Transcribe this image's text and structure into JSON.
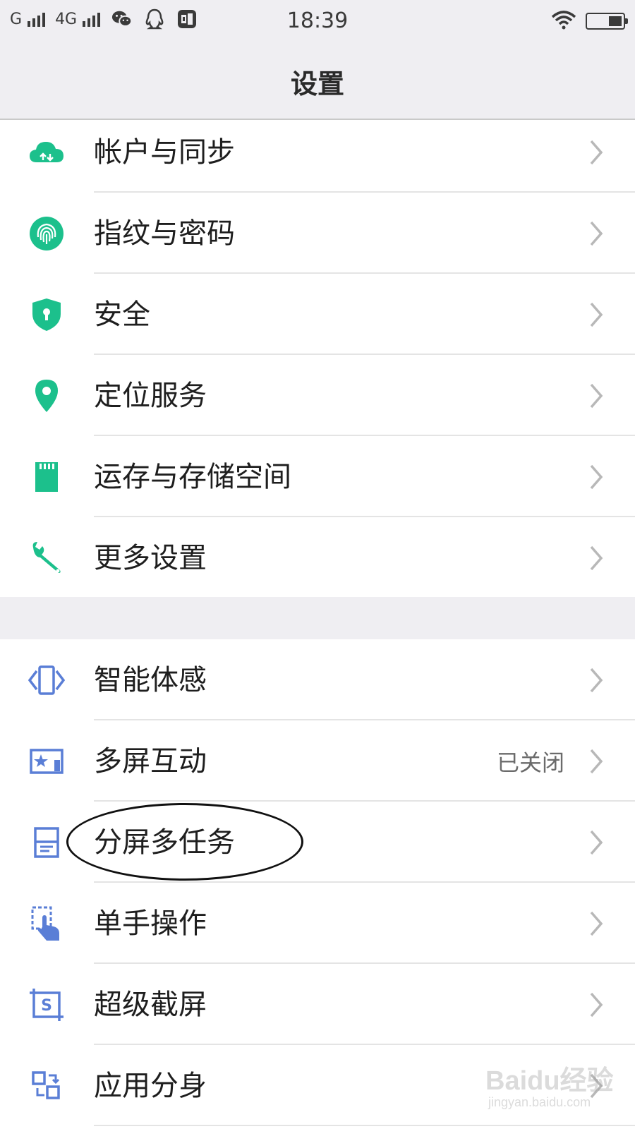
{
  "status_bar": {
    "carrier1": "G",
    "carrier2": "4G",
    "time": "18:39",
    "icons": [
      "signal-bars",
      "signal-bars",
      "wechat-icon",
      "qq-icon",
      "music-app-icon",
      "wifi-icon",
      "battery-icon"
    ]
  },
  "header": {
    "title": "设置"
  },
  "colors": {
    "green_icon": "#1cc08c",
    "blue_icon": "#5a7ed6",
    "chevron": "#b8b8b8",
    "gap_bg": "#efeef2"
  },
  "section1": [
    {
      "label": "帐户与同步",
      "icon": "cloud-sync-icon"
    },
    {
      "label": "指纹与密码",
      "icon": "fingerprint-icon"
    },
    {
      "label": "安全",
      "icon": "shield-icon"
    },
    {
      "label": "定位服务",
      "icon": "location-pin-icon"
    },
    {
      "label": "运存与存储空间",
      "icon": "sd-card-icon"
    },
    {
      "label": "更多设置",
      "icon": "wrench-icon"
    }
  ],
  "section2": [
    {
      "label": "智能体感",
      "icon": "motion-phone-icon",
      "value": ""
    },
    {
      "label": "多屏互动",
      "icon": "screen-cast-icon",
      "value": "已关闭"
    },
    {
      "label": "分屏多任务",
      "icon": "split-screen-icon",
      "value": ""
    },
    {
      "label": "单手操作",
      "icon": "one-hand-icon",
      "value": ""
    },
    {
      "label": "超级截屏",
      "icon": "screenshot-icon",
      "value": ""
    },
    {
      "label": "应用分身",
      "icon": "app-clone-icon",
      "value": ""
    }
  ],
  "watermark": {
    "brand": "Baidu经验",
    "url": "jingyan.baidu.com"
  }
}
